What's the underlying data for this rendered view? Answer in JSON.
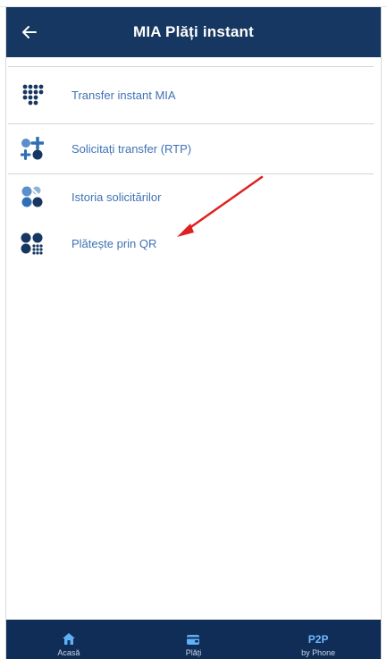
{
  "appbar": {
    "title": "MIA Plăți instant",
    "back_icon": "arrow-left-icon"
  },
  "menu": {
    "items": [
      {
        "label": "Transfer instant MIA",
        "icon": "dots-grid-icon"
      },
      {
        "label": "Solicitați transfer (RTP)",
        "icon": "request-transfer-icon"
      },
      {
        "label": "Istoria solicitărilor",
        "icon": "history-requests-icon"
      },
      {
        "label": "Plătește prin QR",
        "icon": "qr-pay-icon"
      }
    ]
  },
  "annotation": {
    "arrow_color": "#e02020",
    "icon": "red-arrow-icon"
  },
  "bottom_nav": {
    "tabs": [
      {
        "label": "Acasă",
        "icon": "home-icon"
      },
      {
        "label": "Plăți",
        "icon": "wallet-icon"
      },
      {
        "label": "by Phone",
        "badge": "P2P"
      }
    ]
  },
  "colors": {
    "appbar": "#163761",
    "bottom_nav": "#0f2d56",
    "item_text": "#3f72b4",
    "icon_blue": "#2f6fb3"
  }
}
